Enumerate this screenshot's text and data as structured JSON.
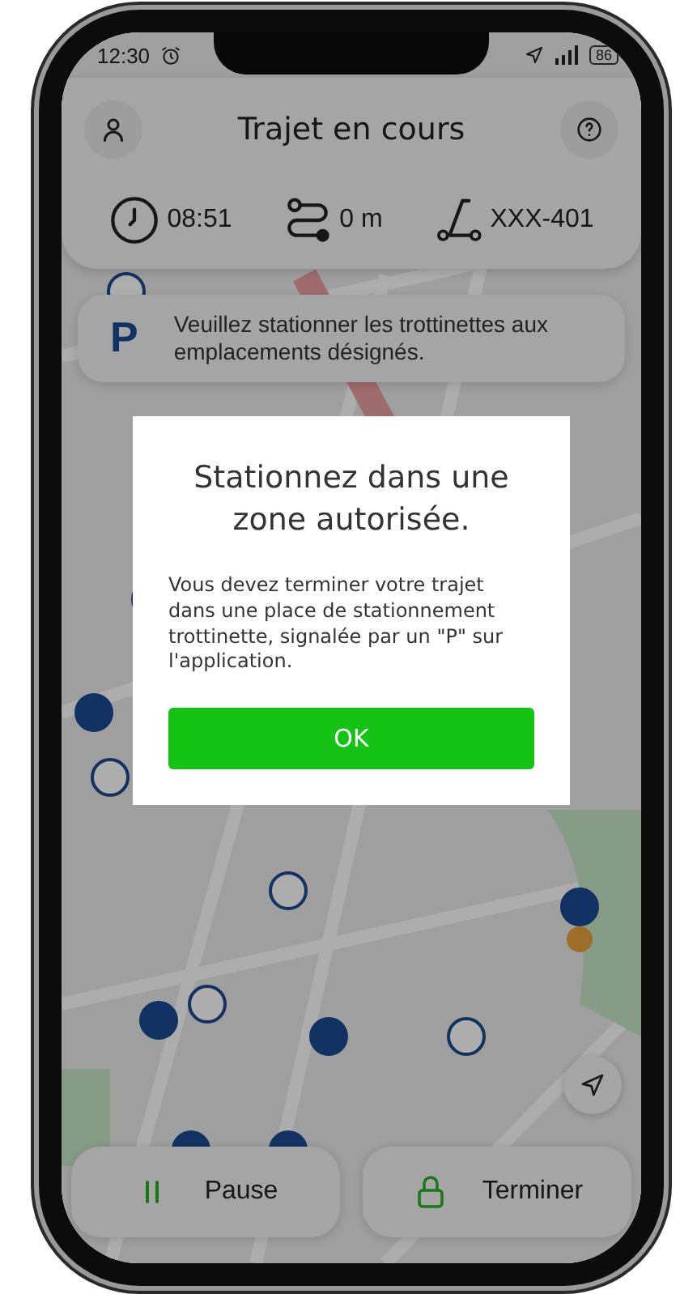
{
  "status_bar": {
    "time": "12:30",
    "battery": "86"
  },
  "header": {
    "title": "Trajet en cours"
  },
  "stats": [
    {
      "kind": "clock",
      "value": "08:51"
    },
    {
      "kind": "route",
      "value": "0 m"
    },
    {
      "kind": "scooter",
      "value": "XXX-401"
    }
  ],
  "notice": {
    "icon": "P",
    "text": "Veuillez stationner les trottinettes aux emplacements désignés."
  },
  "dialog": {
    "title": "Stationnez dans une zone autorisée.",
    "message": "Vous devez terminer votre trajet dans une place de stationnement trottinette, signalée par un \"P\" sur l'application.",
    "button": "OK"
  },
  "actions": [
    {
      "kind": "pause",
      "label": "Pause"
    },
    {
      "kind": "end",
      "label": "Terminer"
    }
  ]
}
